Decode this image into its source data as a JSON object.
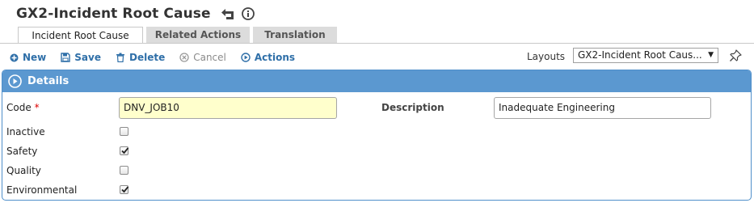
{
  "header": {
    "title": "GX2-Incident Root Cause"
  },
  "tabs": [
    {
      "label": "Incident Root Cause",
      "active": true
    },
    {
      "label": "Related Actions",
      "active": false
    },
    {
      "label": "Translation",
      "active": false
    }
  ],
  "toolbar": {
    "new_label": "New",
    "save_label": "Save",
    "delete_label": "Delete",
    "cancel_label": "Cancel",
    "actions_label": "Actions"
  },
  "layouts": {
    "label": "Layouts",
    "selected": "GX2-Incident Root Caus..."
  },
  "panel": {
    "title": "Details"
  },
  "form": {
    "code_label": "Code",
    "code_required": "*",
    "code_value": "DNV_JOB10",
    "description_label": "Description",
    "description_value": "Inadequate Engineering",
    "checkboxes": [
      {
        "label": "Inactive",
        "checked": false
      },
      {
        "label": "Safety",
        "checked": true
      },
      {
        "label": "Quality",
        "checked": false
      },
      {
        "label": "Environmental",
        "checked": true
      }
    ]
  },
  "colors": {
    "panel_header": "#5b98d0",
    "panel_border": "#4f8fca",
    "toolbar_link": "#2f6fa8",
    "required_input_bg": "#ffffcc",
    "required_marker": "#dd0000"
  },
  "icons": {
    "back": "undo-arrow-icon",
    "info": "info-icon",
    "new": "plus-circle-icon",
    "save": "floppy-disk-icon",
    "delete": "trash-icon",
    "cancel": "cancel-circle-icon",
    "actions": "play-circle-icon",
    "pin": "pin-icon",
    "expand": "play-circle-icon"
  }
}
